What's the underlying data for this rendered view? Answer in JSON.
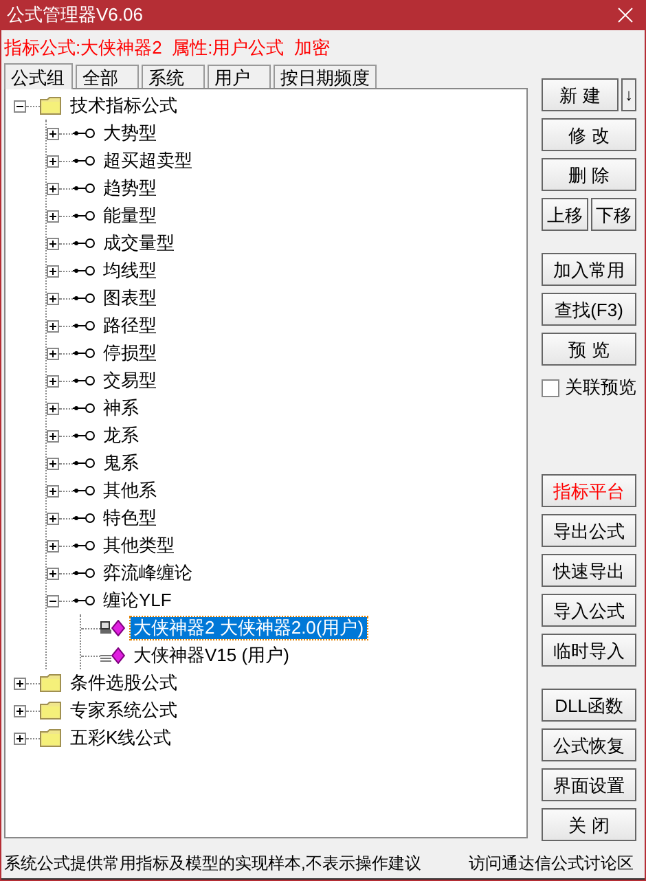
{
  "window": {
    "title": "公式管理器V6.06"
  },
  "info_line": "指标公式:大侠神器2  属性:用户公式  加密",
  "tabs": [
    {
      "label": "公式组",
      "selected": true
    },
    {
      "label": "全部",
      "selected": false
    },
    {
      "label": "系统",
      "selected": false
    },
    {
      "label": "用户",
      "selected": false
    },
    {
      "label": "按日期频度",
      "selected": false
    }
  ],
  "tree": [
    {
      "label": "技术指标公式",
      "kind": "folder",
      "expanded": true,
      "children": [
        {
          "label": "大势型",
          "kind": "group",
          "expanded": false
        },
        {
          "label": "超买超卖型",
          "kind": "group",
          "expanded": false
        },
        {
          "label": "趋势型",
          "kind": "group",
          "expanded": false
        },
        {
          "label": "能量型",
          "kind": "group",
          "expanded": false
        },
        {
          "label": "成交量型",
          "kind": "group",
          "expanded": false
        },
        {
          "label": "均线型",
          "kind": "group",
          "expanded": false
        },
        {
          "label": "图表型",
          "kind": "group",
          "expanded": false
        },
        {
          "label": "路径型",
          "kind": "group",
          "expanded": false
        },
        {
          "label": "停损型",
          "kind": "group",
          "expanded": false
        },
        {
          "label": "交易型",
          "kind": "group",
          "expanded": false
        },
        {
          "label": "神系",
          "kind": "group",
          "expanded": false
        },
        {
          "label": "龙系",
          "kind": "group",
          "expanded": false
        },
        {
          "label": "鬼系",
          "kind": "group",
          "expanded": false
        },
        {
          "label": "其他系",
          "kind": "group",
          "expanded": false
        },
        {
          "label": "特色型",
          "kind": "group",
          "expanded": false
        },
        {
          "label": "其他类型",
          "kind": "group",
          "expanded": false
        },
        {
          "label": "弈流峰缠论",
          "kind": "group",
          "expanded": false
        },
        {
          "label": "缠论YLF",
          "kind": "group",
          "expanded": true,
          "children": [
            {
              "label": "大侠神器2  大侠神器2.0(用户)",
              "kind": "formula",
              "locked": true,
              "selected": true
            },
            {
              "label": "大侠神器V15  (用户)",
              "kind": "formula",
              "locked": false,
              "selected": false
            }
          ]
        }
      ]
    },
    {
      "label": "条件选股公式",
      "kind": "folder",
      "expanded": false
    },
    {
      "label": "专家系统公式",
      "kind": "folder",
      "expanded": false
    },
    {
      "label": "五彩K线公式",
      "kind": "folder",
      "expanded": false
    }
  ],
  "button_groups": [
    [
      [
        {
          "label": "新 建",
          "kind": "button"
        },
        {
          "label": "↓",
          "kind": "small"
        }
      ],
      [
        {
          "label": "修 改",
          "kind": "button"
        }
      ],
      [
        {
          "label": "删 除",
          "kind": "button"
        }
      ],
      [
        {
          "label": "上移",
          "kind": "button"
        },
        {
          "label": "下移",
          "kind": "button"
        }
      ]
    ],
    [
      [
        {
          "label": "加入常用",
          "kind": "button"
        }
      ],
      [
        {
          "label": "查找(F3)",
          "kind": "button"
        }
      ],
      [
        {
          "label": "预 览",
          "kind": "button"
        }
      ],
      [
        {
          "label": "关联预览",
          "kind": "checkbox",
          "checked": false
        }
      ]
    ],
    [
      [
        {
          "label": "指标平台",
          "kind": "button",
          "highlight": true
        }
      ],
      [
        {
          "label": "导出公式",
          "kind": "button"
        }
      ],
      [
        {
          "label": "快速导出",
          "kind": "button"
        }
      ],
      [
        {
          "label": "导入公式",
          "kind": "button"
        }
      ],
      [
        {
          "label": "临时导入",
          "kind": "button"
        }
      ]
    ],
    [
      [
        {
          "label": "DLL函数",
          "kind": "button"
        }
      ],
      [
        {
          "label": "公式恢复",
          "kind": "button"
        }
      ],
      [
        {
          "label": "界面设置",
          "kind": "button"
        }
      ],
      [
        {
          "label": "关 闭",
          "kind": "button"
        }
      ]
    ]
  ],
  "status_bar": {
    "message": "系统公式提供常用指标及模型的实现样本,不表示操作建议",
    "link": "访问通达信公式讨论区"
  }
}
